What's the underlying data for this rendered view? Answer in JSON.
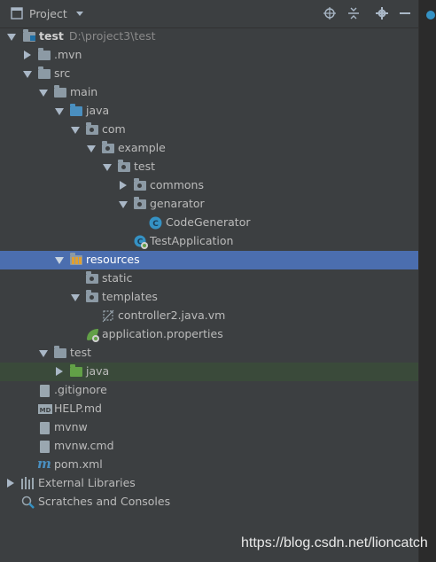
{
  "toolbar": {
    "title": "Project"
  },
  "tree": [
    {
      "label": "test",
      "note": "D:\\project3\\test",
      "bold": true
    },
    {
      "label": ".mvn"
    },
    {
      "label": "src"
    },
    {
      "label": "main"
    },
    {
      "label": "java"
    },
    {
      "label": "com"
    },
    {
      "label": "example"
    },
    {
      "label": "test"
    },
    {
      "label": "commons"
    },
    {
      "label": "genarator"
    },
    {
      "label": "CodeGenerator"
    },
    {
      "label": "TestApplication"
    },
    {
      "label": "resources"
    },
    {
      "label": "static"
    },
    {
      "label": "templates"
    },
    {
      "label": "controller2.java.vm"
    },
    {
      "label": "application.properties"
    },
    {
      "label": "test"
    },
    {
      "label": "java"
    },
    {
      "label": ".gitignore"
    },
    {
      "label": "HELP.md"
    },
    {
      "label": "mvnw"
    },
    {
      "label": "mvnw.cmd"
    },
    {
      "label": "pom.xml"
    },
    {
      "label": "External Libraries"
    },
    {
      "label": "Scratches and Consoles"
    }
  ],
  "watermark": "https://blog.csdn.net/lioncatch",
  "colors": {
    "selection": "#4b6eaf",
    "panel": "#3c3f41",
    "folder_blue": "#4a8fc0",
    "folder_green": "#62a047"
  }
}
